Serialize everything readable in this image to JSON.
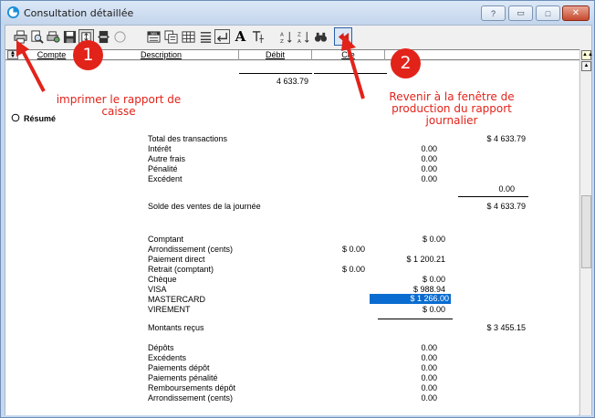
{
  "window": {
    "title": "Consultation détaillée",
    "help_glyph": "?",
    "minimize_glyph": "▭",
    "maximize_glyph": "□",
    "close_glyph": "✕"
  },
  "toolbar": {
    "icons": [
      "print-icon",
      "print-preview-icon",
      "print-setup-icon",
      "save-icon",
      "dimensions-icon",
      "merge-icon",
      "empty-circle-icon",
      "win-icon",
      "multi-doc-icon",
      "grid-icon",
      "lines-icon",
      "return-icon",
      "font-icon",
      "text-format-icon",
      "sort-az-icon",
      "sort-za-icon",
      "find-icon",
      "back-to-daily-production-icon"
    ],
    "font_glyph": "A",
    "win_label": "WIN"
  },
  "columns": {
    "compte": "Compte",
    "description": "Description",
    "debit": "Débit",
    "credit": "Cre"
  },
  "top_total": "4 633.79",
  "section_title": "Résumé",
  "totals_block": {
    "label_total": "Total des transactions",
    "total_value": "$ 4 633.79",
    "rows": [
      {
        "label": "Intérêt",
        "value": "0.00"
      },
      {
        "label": "Autre frais",
        "value": "0.00"
      },
      {
        "label": "Pénalité",
        "value": "0.00"
      },
      {
        "label": "Excédent",
        "value": "0.00"
      }
    ],
    "subtotal": "0.00",
    "solde_label": "Solde des ventes de la journée",
    "solde_value": "$ 4 633.79"
  },
  "payments": [
    {
      "label": "Comptant",
      "left": "",
      "right": "$ 0.00",
      "highlight": false
    },
    {
      "label": "Arrondissement (cents)",
      "left": "$ 0.00",
      "right": "",
      "highlight": false
    },
    {
      "label": "Paiement direct",
      "left": "",
      "right": "$ 1 200.21",
      "highlight": false
    },
    {
      "label": "Retrait (comptant)",
      "left": "$ 0.00",
      "right": "",
      "highlight": false
    },
    {
      "label": "Chèque",
      "left": "",
      "right": "$ 0.00",
      "highlight": false
    },
    {
      "label": "VISA",
      "left": "",
      "right": "$ 988.94",
      "highlight": false
    },
    {
      "label": "MASTERCARD",
      "left": "",
      "right": "$ 1 266.00",
      "highlight": true
    },
    {
      "label": "VIREMENT",
      "left": "",
      "right": "$ 0.00",
      "highlight": false
    }
  ],
  "montants": {
    "label": "Montants reçus",
    "value": "$ 3 455.15"
  },
  "deposits": [
    {
      "label": "Dépôts",
      "value": "0.00"
    },
    {
      "label": "Excédents",
      "value": "0.00"
    },
    {
      "label": "Paiements dépôt",
      "value": "0.00"
    },
    {
      "label": "Paiements pénalité",
      "value": "0.00"
    },
    {
      "label": "Remboursements dépôt",
      "value": "0.00"
    },
    {
      "label": "Arrondissement (cents)",
      "value": "0.00"
    }
  ],
  "annotations": {
    "badge1": "1",
    "badge2": "2",
    "note1": "imprimer le rapport de caisse",
    "note2": "Revenir à la fenêtre de production du rapport journalier"
  },
  "colors": {
    "annotation_red": "#e2231a",
    "highlight_blue": "#0a6cd0"
  }
}
